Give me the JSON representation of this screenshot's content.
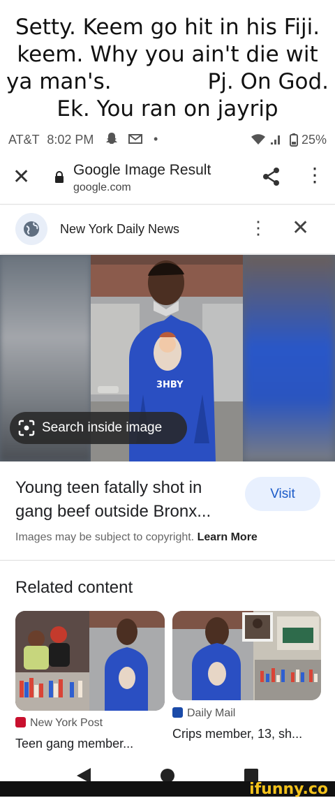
{
  "caption": {
    "line1": "Setty. Keem go hit in his Fiji.",
    "line2": "keem. Why you ain't die wit",
    "line3": "ya man's.              Pj. On God.",
    "line4": "Ek. You ran on jayrip"
  },
  "status_bar": {
    "carrier": "AT&T",
    "time": "8:02 PM",
    "battery": "25%"
  },
  "toolbar": {
    "title": "Google Image Result",
    "domain": "google.com"
  },
  "source_bar": {
    "name": "New York Daily News"
  },
  "hero": {
    "search_chip": "Search inside image",
    "shirt_text": "3HBY"
  },
  "result": {
    "headline": "Young teen fatally shot in gang beef outside Bronx...",
    "visit_label": "Visit",
    "copyright_text": "Images may be subject to copyright.",
    "learn_more": "Learn More"
  },
  "related": {
    "title": "Related content",
    "cards": [
      {
        "source": "New York Post",
        "caption": "Teen gang member..."
      },
      {
        "source": "Daily Mail",
        "caption": "Crips member, 13, sh..."
      }
    ]
  },
  "watermark": {
    "text": "ifunny.co"
  },
  "colors": {
    "accent_blue": "#1a5ac8",
    "visit_bg": "#e8f0fe",
    "watermark_yellow": "#f3c21b"
  }
}
